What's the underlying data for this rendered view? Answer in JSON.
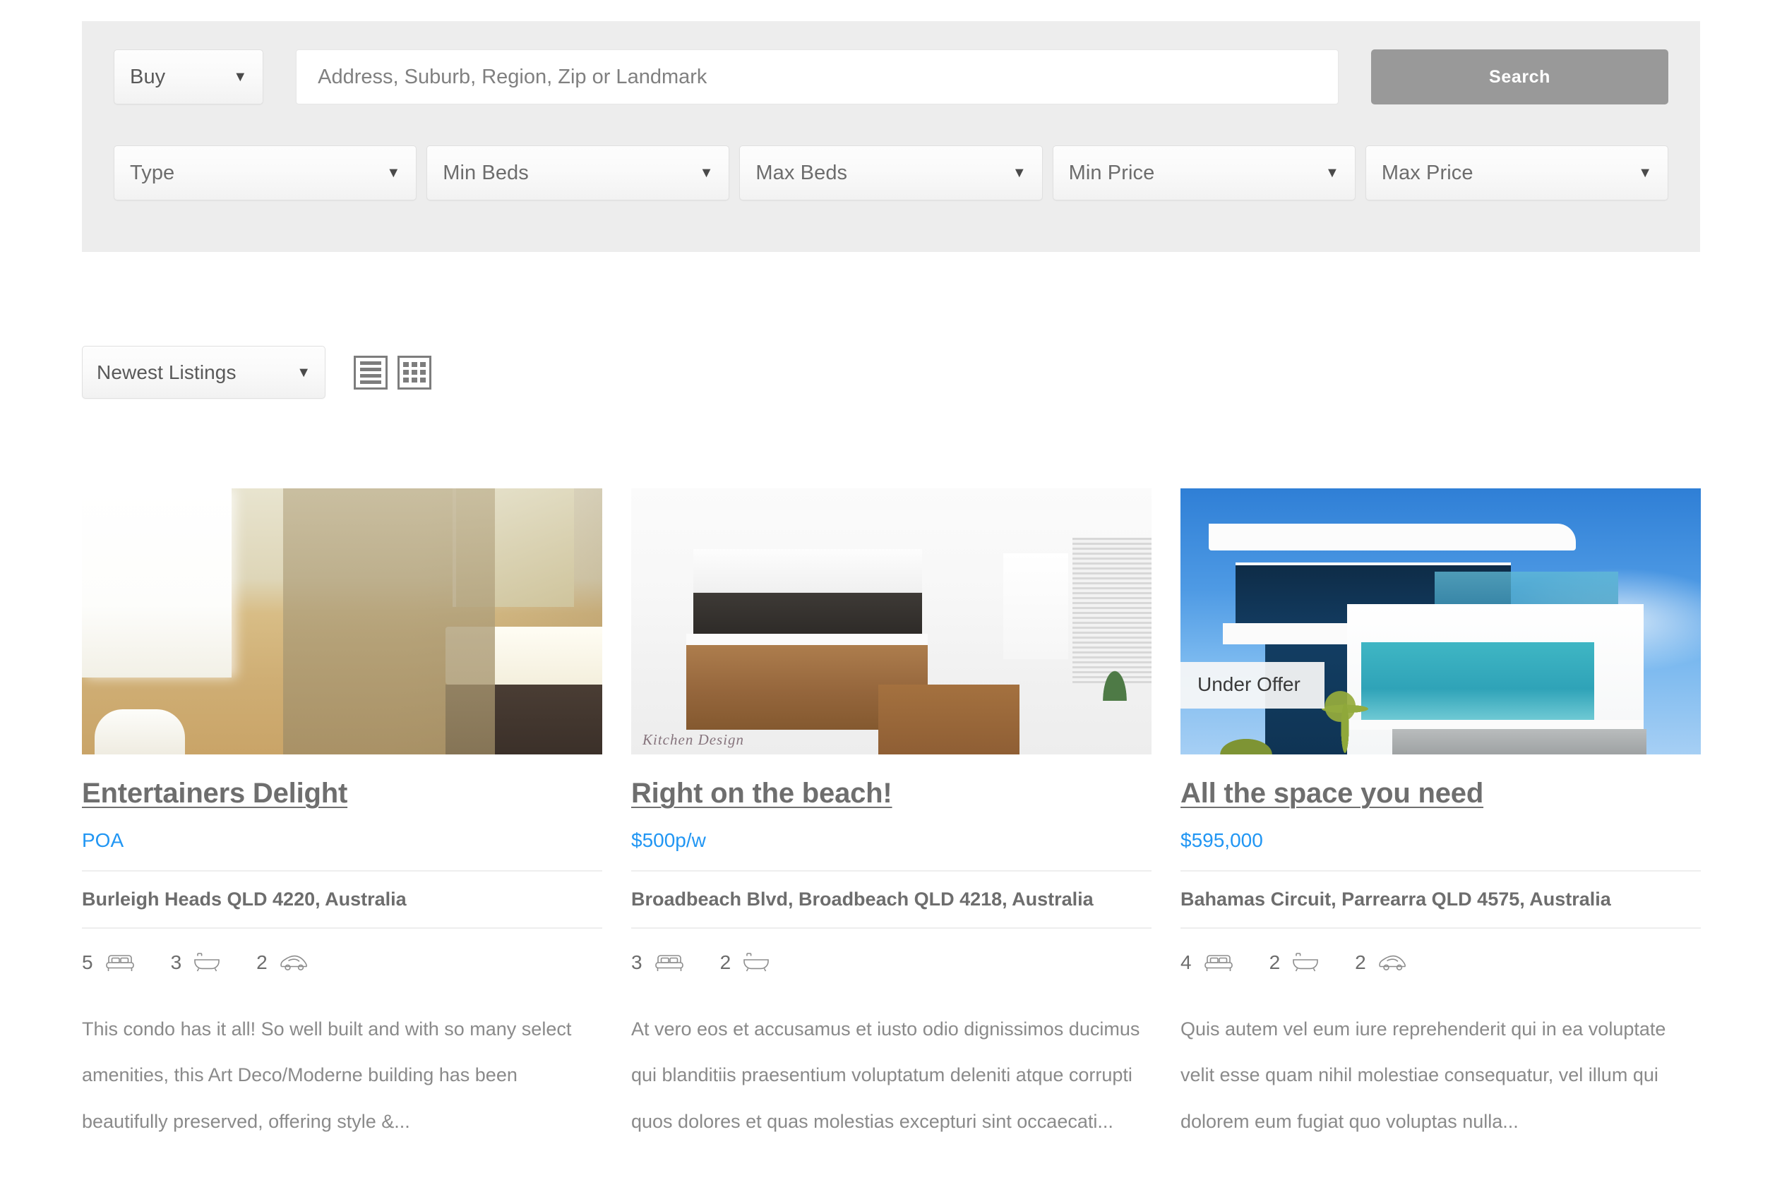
{
  "search": {
    "type_select": {
      "label": "Buy",
      "caret": "chevron-down-icon"
    },
    "location_input": {
      "value": "",
      "placeholder": "Address, Suburb, Region, Zip or Landmark"
    },
    "search_button": "Search",
    "filters": [
      {
        "label": "Type"
      },
      {
        "label": "Min Beds"
      },
      {
        "label": "Max Beds"
      },
      {
        "label": "Min Price"
      },
      {
        "label": "Max Price"
      }
    ]
  },
  "toolbar": {
    "sort_select": "Newest Listings",
    "view_list": "list-view-icon",
    "view_grid": "grid-view-icon"
  },
  "listings": [
    {
      "title": "Entertainers Delight",
      "price": "POA",
      "address": "Burleigh Heads QLD 4220, Australia",
      "beds": "5",
      "baths": "3",
      "cars": "2",
      "description": "This condo has it all! So well built and with so many select amenities, this Art Deco/Moderne building has been beautifully preserved, offering style &...",
      "badge": "",
      "photo": "bathroom-photo"
    },
    {
      "title": "Right on the beach!",
      "price": "$500p/w",
      "address": "Broadbeach Blvd, Broadbeach QLD 4218, Australia",
      "beds": "3",
      "baths": "2",
      "cars": "",
      "description": "At vero eos et accusamus et iusto odio dignissimos ducimus qui blanditiis praesentium voluptatum deleniti atque corrupti quos dolores et quas molestias excepturi sint occaecati...",
      "badge": "",
      "photo": "kitchen-photo",
      "watermark": "Kitchen Design"
    },
    {
      "title": "All the space you need",
      "price": "$595,000",
      "address": "Bahamas Circuit, Parrearra QLD 4575, Australia",
      "beds": "4",
      "baths": "2",
      "cars": "2",
      "description": "Quis autem vel eum iure reprehenderit qui in ea voluptate velit esse quam nihil molestiae consequatur, vel illum qui dolorem eum fugiat quo voluptas nulla...",
      "badge": "Under Offer",
      "photo": "house-photo"
    }
  ],
  "colors": {
    "panel_bg": "#ededed",
    "search_button": "#999999",
    "price_link": "#2196f3",
    "heading": "#6e6e6e",
    "body_text": "#8a8a8a"
  }
}
